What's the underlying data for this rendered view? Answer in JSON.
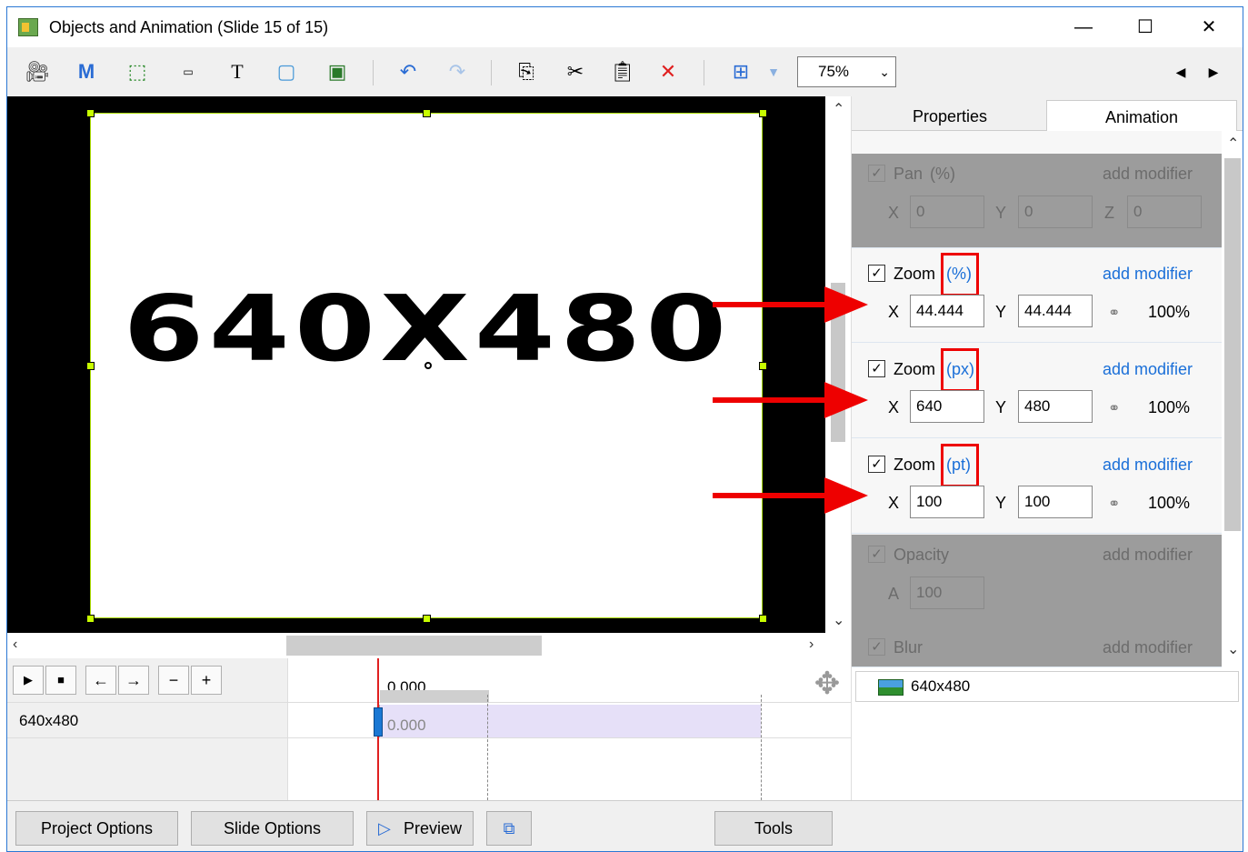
{
  "window": {
    "title": "Objects and Animation (Slide 15 of 15)",
    "minimize": "—",
    "maximize": "☐",
    "close": "✕"
  },
  "toolbar": {
    "zoom_value": "75%",
    "icons": [
      "camera-icon",
      "mask-icon",
      "frame-icon",
      "button-icon",
      "text-icon",
      "rectangle-icon",
      "image-icon",
      "undo-icon",
      "redo-icon",
      "copy-icon",
      "cut-icon",
      "paste-icon",
      "delete-icon",
      "grid-icon",
      "prev-icon",
      "next-icon"
    ]
  },
  "slide": {
    "text": "640X480"
  },
  "tabs": {
    "properties": "Properties",
    "animation": "Animation"
  },
  "animation": {
    "pan": {
      "name": "Pan",
      "unit": "(%)",
      "add": "add modifier",
      "x_label": "X",
      "y_label": "Y",
      "z_label": "Z",
      "x": "0",
      "y": "0",
      "z": "0"
    },
    "zoom_pct": {
      "name": "Zoom",
      "unit": "(%)",
      "add": "add modifier",
      "x_label": "X",
      "y_label": "Y",
      "x": "44.444",
      "y": "44.444",
      "ratio": "100%"
    },
    "zoom_px": {
      "name": "Zoom",
      "unit": "(px)",
      "add": "add modifier",
      "x_label": "X",
      "y_label": "Y",
      "x": "640",
      "y": "480",
      "ratio": "100%"
    },
    "zoom_pt": {
      "name": "Zoom",
      "unit": "(pt)",
      "add": "add modifier",
      "x_label": "X",
      "y_label": "Y",
      "x": "100",
      "y": "100",
      "ratio": "100%"
    },
    "opacity": {
      "name": "Opacity",
      "add": "add modifier",
      "a_label": "A",
      "a": "100"
    },
    "blur": {
      "name": "Blur",
      "add": "add modifier"
    }
  },
  "objects": [
    {
      "label": "640x480"
    }
  ],
  "timeline": {
    "time": "0.000",
    "row_label": "640x480",
    "row_time": "0.000"
  },
  "buttons": {
    "project_options": "Project Options",
    "slide_options": "Slide Options",
    "preview": "Preview",
    "tools": "Tools"
  }
}
